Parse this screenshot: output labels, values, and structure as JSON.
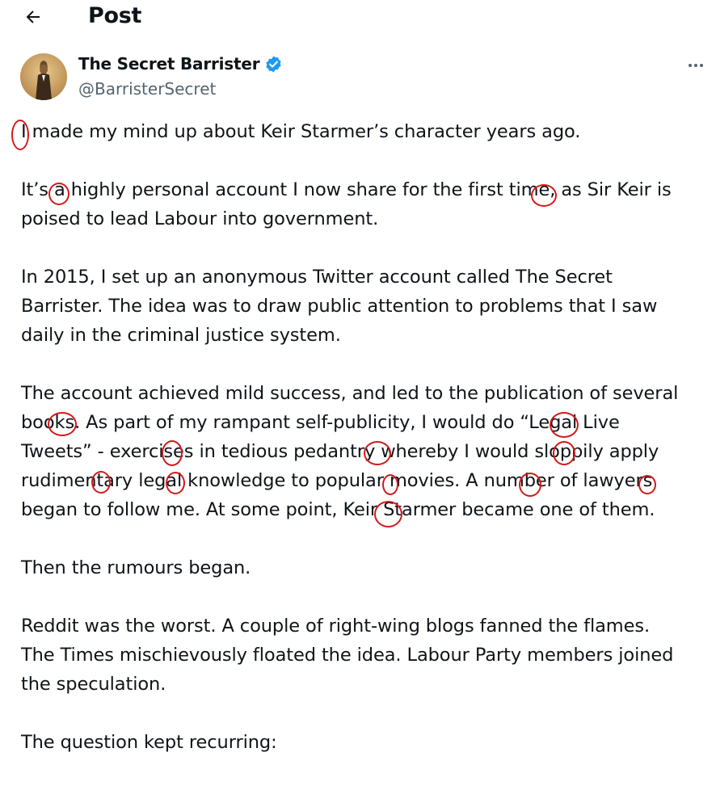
{
  "header": {
    "title": "Post",
    "back_icon": "arrow-left-icon"
  },
  "author": {
    "display_name": "The Secret Barrister",
    "handle": "@BarristerSecret",
    "verified": true,
    "verified_color": "#1d9bf0",
    "avatar_icon": "avatar-figure"
  },
  "more_icon": "more-horizontal-icon",
  "colors": {
    "text": "#0f1419",
    "secondary_text": "#536471",
    "annotation_ring": "#d21a1a"
  },
  "post": {
    "paragraphs": [
      "I made my mind up about Keir Starmer’s character years ago.",
      "It’s a highly personal account I now share for the first time, as Sir Keir is\npoised to lead Labour into government.",
      "In 2015, I set up an anonymous Twitter account called The Secret\nBarrister. The idea was to draw public attention to problems that I saw\ndaily in the criminal justice system.",
      "The account achieved mild success, and led to the publication of several\nbooks. As part of my rampant self-publicity, I would do “Legal Live\nTweets” - exercises in tedious pedantry whereby I would sloppily apply\nrudimentary legal knowledge to popular movies. A number of lawyers\nbegan to follow me. At some point, Keir Starmer became one of them.",
      "Then the rumours began.",
      "Reddit was the worst. A couple of right-wing blogs fanned the flames.\nThe Times mischievously floated the idea. Labour Party members joined\nthe speculation.",
      "The question kept recurring:"
    ]
  }
}
